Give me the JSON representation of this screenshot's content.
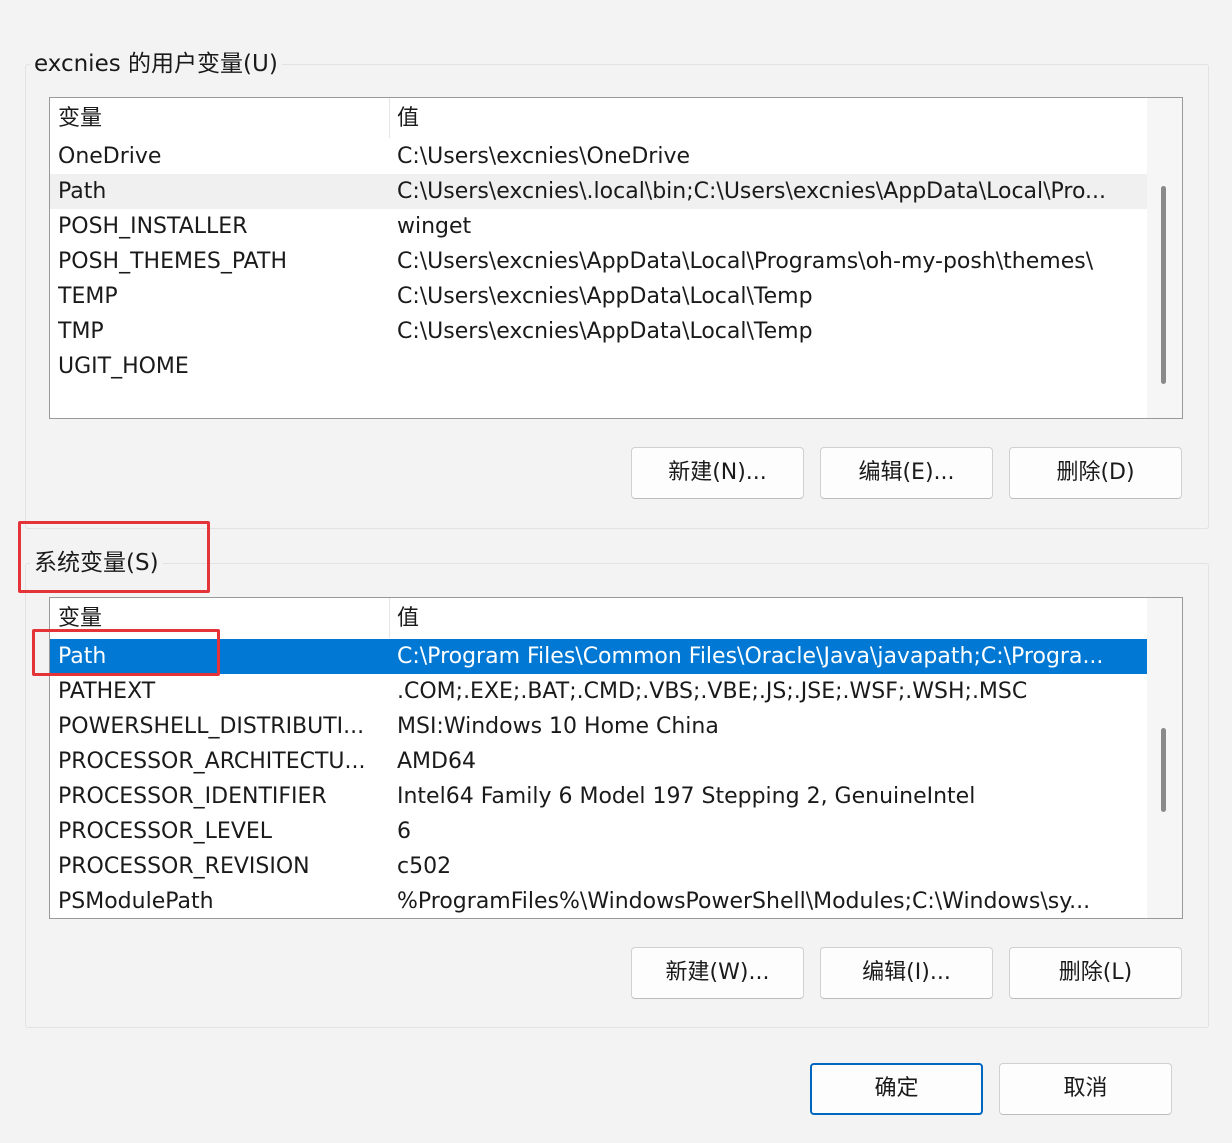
{
  "user_vars": {
    "title": "excnies 的用户变量(U)",
    "header": {
      "name": "变量",
      "value": "值"
    },
    "rows": [
      {
        "name": "OneDrive",
        "value": "C:\\Users\\excnies\\OneDrive"
      },
      {
        "name": "Path",
        "value": "C:\\Users\\excnies\\.local\\bin;C:\\Users\\excnies\\AppData\\Local\\Pro..."
      },
      {
        "name": "POSH_INSTALLER",
        "value": "winget"
      },
      {
        "name": "POSH_THEMES_PATH",
        "value": "C:\\Users\\excnies\\AppData\\Local\\Programs\\oh-my-posh\\themes\\"
      },
      {
        "name": "TEMP",
        "value": "C:\\Users\\excnies\\AppData\\Local\\Temp"
      },
      {
        "name": "TMP",
        "value": "C:\\Users\\excnies\\AppData\\Local\\Temp"
      },
      {
        "name": "UGIT_HOME",
        "value": ""
      }
    ],
    "buttons": {
      "new": "新建(N)...",
      "edit": "编辑(E)...",
      "delete": "删除(D)"
    }
  },
  "system_vars": {
    "title": "系统变量(S)",
    "header": {
      "name": "变量",
      "value": "值"
    },
    "rows": [
      {
        "name": "Path",
        "value": "C:\\Program Files\\Common Files\\Oracle\\Java\\javapath;C:\\Progra..."
      },
      {
        "name": "PATHEXT",
        "value": ".COM;.EXE;.BAT;.CMD;.VBS;.VBE;.JS;.JSE;.WSF;.WSH;.MSC"
      },
      {
        "name": "POWERSHELL_DISTRIBUTI...",
        "value": "MSI:Windows 10 Home China"
      },
      {
        "name": "PROCESSOR_ARCHITECTU...",
        "value": "AMD64"
      },
      {
        "name": "PROCESSOR_IDENTIFIER",
        "value": "Intel64 Family 6 Model 197 Stepping 2, GenuineIntel"
      },
      {
        "name": "PROCESSOR_LEVEL",
        "value": "6"
      },
      {
        "name": "PROCESSOR_REVISION",
        "value": "c502"
      },
      {
        "name": "PSModulePath",
        "value": "%ProgramFiles%\\WindowsPowerShell\\Modules;C:\\Windows\\sy..."
      }
    ],
    "buttons": {
      "new": "新建(W)...",
      "edit": "编辑(I)...",
      "delete": "删除(L)"
    }
  },
  "dialog_buttons": {
    "ok": "确定",
    "cancel": "取消"
  },
  "colors": {
    "selection": "#0078d4",
    "annotation": "#e5333a",
    "default_button_border": "#0067c0"
  }
}
